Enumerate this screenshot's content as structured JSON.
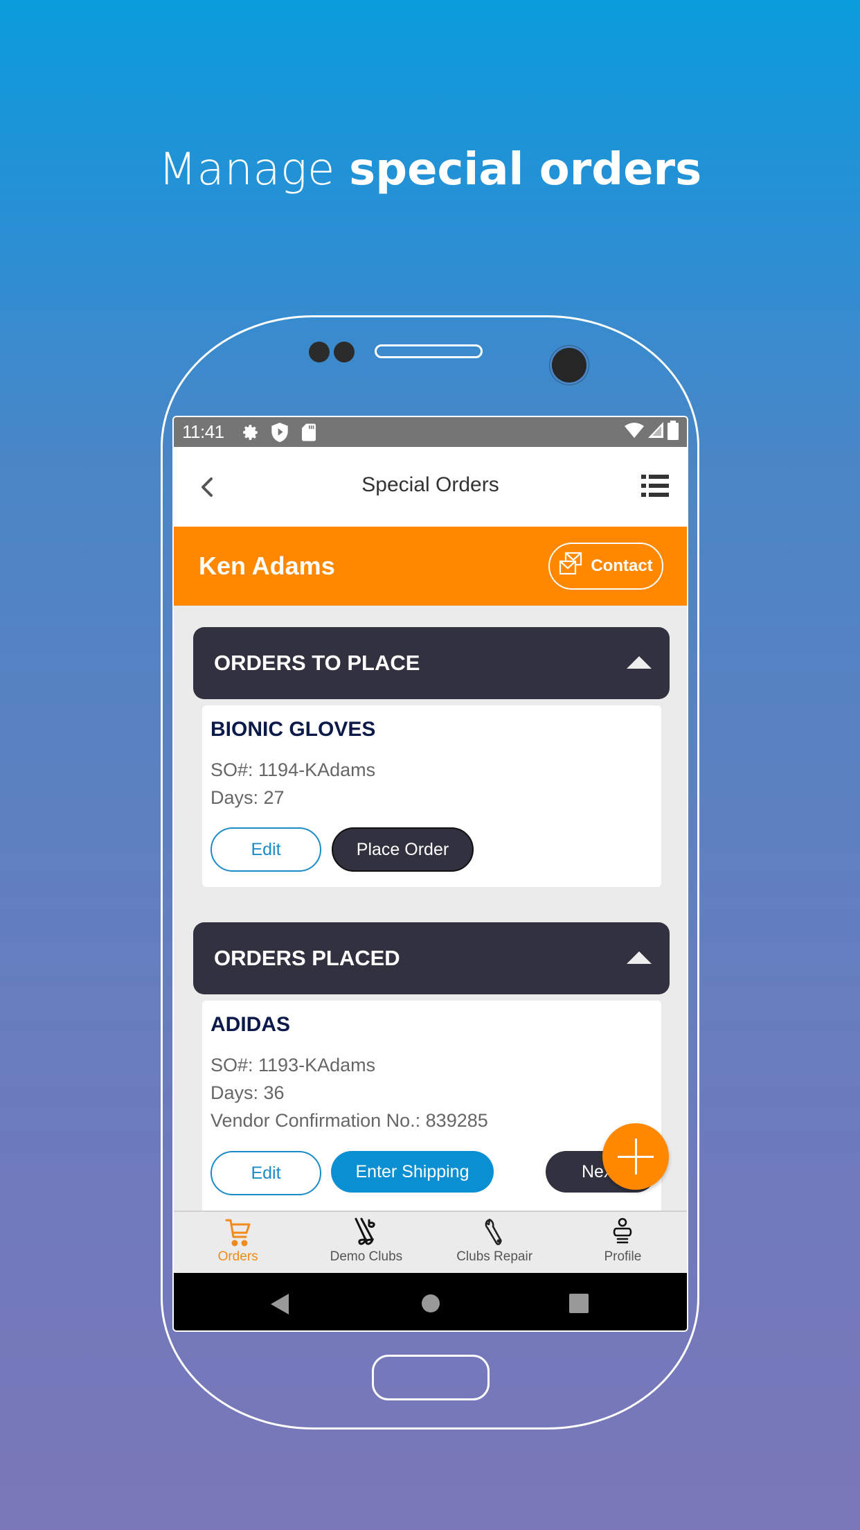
{
  "promo": {
    "headline_light": "Manage",
    "headline_bold": "special orders"
  },
  "colors": {
    "accent_orange": "#ff8800",
    "dark_header": "#31313f",
    "primary_blue": "#0a8fd2",
    "title_navy": "#0c1a4a"
  },
  "statusbar": {
    "time": "11:41",
    "left_icons": [
      "gear-icon",
      "shield-play-icon",
      "sd-card-icon"
    ],
    "right_icons": [
      "wifi-icon",
      "signal-icon",
      "battery-icon"
    ]
  },
  "appbar": {
    "title": "Special Orders",
    "back_icon": "chevron-left-icon",
    "menu_icon": "list-icon"
  },
  "customer": {
    "name": "Ken Adams",
    "contact_label": "Contact",
    "contact_icon": "envelope-icon"
  },
  "sections": [
    {
      "title": "ORDERS TO PLACE",
      "expanded": true,
      "orders": [
        {
          "title": "BIONIC GLOVES",
          "so_number": "SO#: 1194-KAdams",
          "days": "Days: 27",
          "buttons": [
            "Edit",
            "Place Order"
          ]
        }
      ]
    },
    {
      "title": "ORDERS PLACED",
      "expanded": true,
      "orders": [
        {
          "title": "ADIDAS",
          "so_number": "SO#: 1193-KAdams",
          "days": "Days: 36",
          "vendor_confirmation": "Vendor Confirmation No.: 839285",
          "buttons": [
            "Edit",
            "Enter Shipping",
            "Next"
          ]
        }
      ]
    }
  ],
  "fab": {
    "icon": "plus-icon"
  },
  "bottom_nav": {
    "active": "Orders",
    "items": [
      {
        "label": "Orders",
        "icon": "cart-icon"
      },
      {
        "label": "Demo Clubs",
        "icon": "golf-clubs-icon"
      },
      {
        "label": "Clubs Repair",
        "icon": "wrench-icon"
      },
      {
        "label": "Profile",
        "icon": "profile-icon"
      }
    ]
  },
  "system_nav": [
    "back",
    "home",
    "recents"
  ]
}
